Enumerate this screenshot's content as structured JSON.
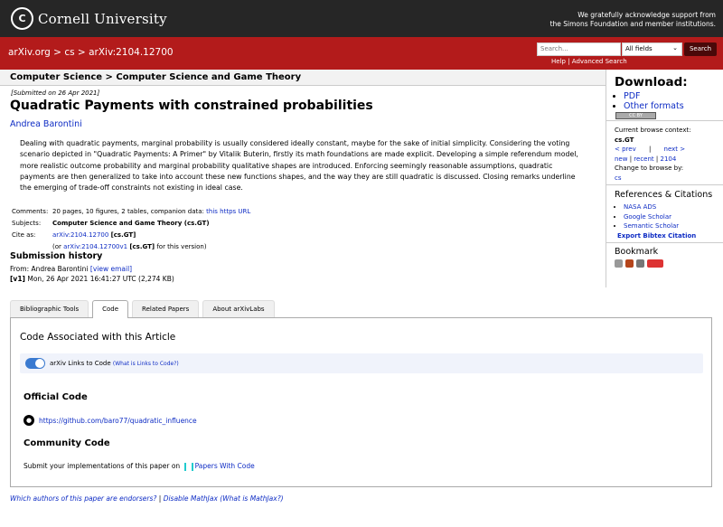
{
  "header": {
    "logo_text": "Cornell University",
    "ack_line1": "We gratefully acknowledge support from",
    "ack_line2": "the Simons Foundation and member institutions."
  },
  "breadcrumb": {
    "site": "arXiv.org",
    "sep1": ">",
    "cat": "cs",
    "sep2": ">",
    "id": "arXiv:2104.12700"
  },
  "search": {
    "placeholder": "Search...",
    "field": "All fields",
    "button": "Search",
    "help": "Help",
    "sep": "|",
    "advanced": "Advanced Search"
  },
  "subject_bar": "Computer Science > Computer Science and Game Theory",
  "paper": {
    "submitted": "[Submitted on 26 Apr 2021]",
    "title": "Quadratic Payments with constrained probabilities",
    "authors": "Andrea Barontini",
    "abstract": "Dealing with quadratic payments, marginal probability is usually considered ideally constant, maybe for the sake of initial simplicity. Considering the voting scenario depicted in \"Quadratic Payments: A Primer\" by Vitalik Buterin, firstly its math foundations are made explicit. Developing a simple referendum model, more realistic outcome probability and marginal probability qualitative shapes are introduced. Enforcing seemingly reasonable assumptions, quadratic payments are then generalized to take into account these new functions shapes, and the way they are still quadratic is discussed. Closing remarks underline the emerging of trade-off constraints not existing in ideal case."
  },
  "meta": {
    "comments_label": "Comments:",
    "comments": "20 pages, 10 figures, 2 tables, companion data:",
    "comments_link": "this https URL",
    "subjects_label": "Subjects:",
    "subjects": "Computer Science and Game Theory (cs.GT)",
    "cite_label": "Cite as:",
    "cite_id": "arXiv:2104.12700",
    "cite_cat": "[cs.GT]",
    "cite_or": "(or",
    "cite_v1": "arXiv:2104.12700v1",
    "cite_v1_cat": "[cs.GT]",
    "cite_v1_rest": "for this version)"
  },
  "history": {
    "heading": "Submission history",
    "from": "From: Andrea Barontini",
    "view_email": "[view email]",
    "v1": "[v1]",
    "v1_date": "Mon, 26 Apr 2021 16:41:27 UTC (2,274 KB)"
  },
  "tabs": [
    "Bibliographic Tools",
    "Code",
    "Related Papers",
    "About arXivLabs"
  ],
  "code_panel": {
    "heading": "Code Associated with this Article",
    "toggle_label": "arXiv Links to Code",
    "toggle_help": "(What is Links to Code?)",
    "official_heading": "Official Code",
    "github_url": "https://github.com/baro77/quadratic_influence",
    "community_heading": "Community Code",
    "community_text": "Submit your implementations of this paper on",
    "pwc_link": "Papers With Code"
  },
  "footer": {
    "endorsers": "Which authors of this paper are endorsers?",
    "sep": "|",
    "mathjax": "Disable MathJax",
    "what_mathjax": "(What is MathJax?)"
  },
  "sidebar": {
    "download_heading": "Download:",
    "pdf": "PDF",
    "other": "Other formats",
    "cc": "CC BY",
    "context_label": "Current browse context:",
    "context": "cs.GT",
    "prev": "< prev",
    "pipe": "|",
    "next": "next >",
    "new": "new",
    "recent": "recent",
    "year": "2104",
    "change_label": "Change to browse by:",
    "cs": "cs",
    "refs_heading": "References & Citations",
    "refs": [
      "NASA ADS",
      "Google Scholar",
      "Semantic Scholar"
    ],
    "bibtex": "Export Bibtex Citation",
    "bookmark_heading": "Bookmark"
  },
  "colors": {
    "red_bar": "#b31b1b",
    "link": "#0e2cc4",
    "toggle": "#3a7ad0"
  }
}
